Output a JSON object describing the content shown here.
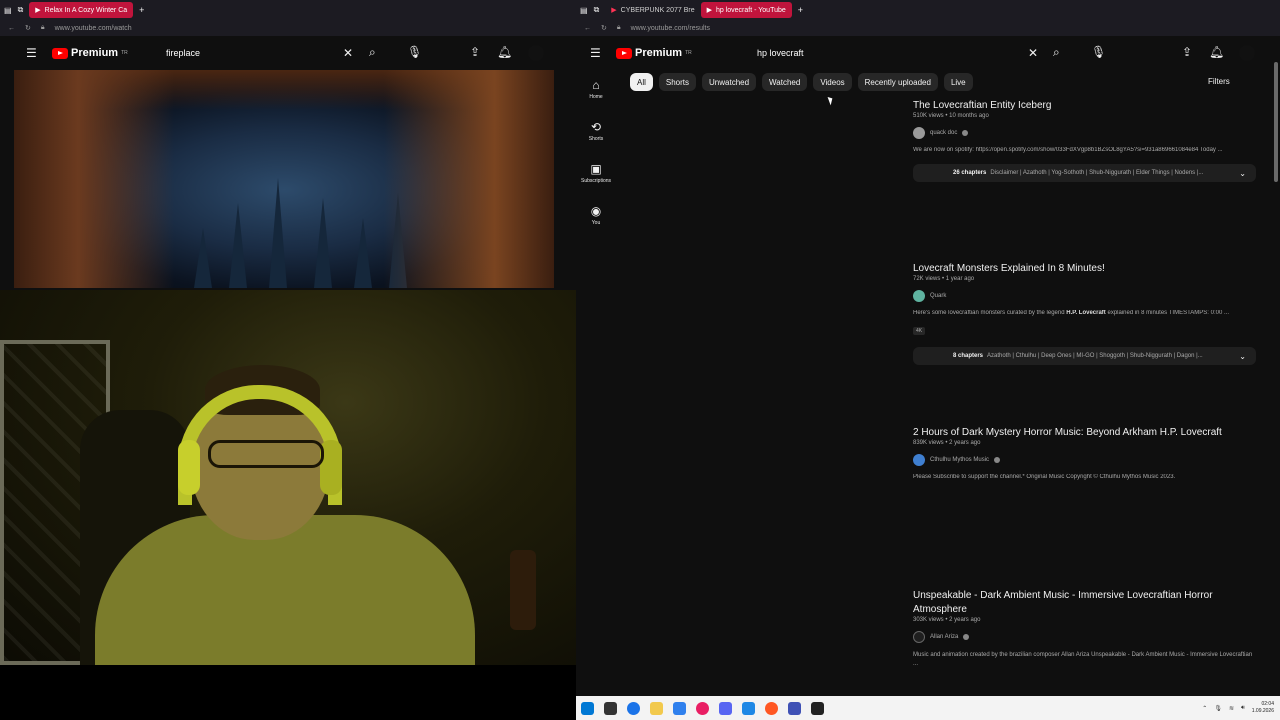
{
  "left_browser": {
    "tab_title": "Relax In A Cozy Winter Ca",
    "url": "www.youtube.com/watch",
    "logo_text": "Premium",
    "logo_region": "TR",
    "search_value": "fireplace"
  },
  "right_browser": {
    "tabs": [
      {
        "label": "CYBERPUNK 2077 Bre"
      },
      {
        "label": "hp lovecraft - YouTube"
      }
    ],
    "url": "www.youtube.com/results",
    "logo_text": "Premium",
    "logo_region": "TR",
    "search_value": "hp lovecraft",
    "sidebar": [
      {
        "label": "Home",
        "icon": "home-icon"
      },
      {
        "label": "Shorts",
        "icon": "shorts-icon"
      },
      {
        "label": "Subscriptions",
        "icon": "subscriptions-icon"
      },
      {
        "label": "You",
        "icon": "you-icon"
      }
    ],
    "chips": [
      "All",
      "Shorts",
      "Unwatched",
      "Watched",
      "Videos",
      "Recently uploaded",
      "Live"
    ],
    "filters_label": "Filters",
    "results": [
      {
        "title": "The Lovecraftian Entity Iceberg",
        "meta": "510K views • 10 months ago",
        "channel": "quack doc",
        "description": "We are now on spotify: https://open.spotify.com/show/033FdXVgp8b1BZsOL8gYA5?si=931a869661084e84 Today ...",
        "chapters_count": "26 chapters",
        "chapters_list": "Disclaimer | Azathoth | Yog-Sothoth | Shub-Niggurath | Elder Things | Nodens |..."
      },
      {
        "title": "Lovecraft Monsters Explained In 8 Minutes!",
        "meta": "72K views • 1 year ago",
        "channel": "Quark",
        "description_pre": "Here's some lovecraftian monsters curated by the legend ",
        "description_bold": "H.P. Lovecraft",
        "description_post": " explained in 8 minutes TIMESTAMPS: 0:00 ...",
        "badge": "4K",
        "chapters_count": "8 chapters",
        "chapters_list": "Azathoth | Cthulhu | Deep Ones | MI-GO | Shoggoth | Shub-Niggurath | Dagon |..."
      },
      {
        "title": "2 Hours of Dark Mystery Horror Music: Beyond Arkham H.P. Lovecraft",
        "meta": "839K views • 2 years ago",
        "channel": "Cthulhu Mythos Music",
        "description": "Please Subscribe to support the channel.* Original Music Copyright © Cthulhu Mythos Music 2023."
      },
      {
        "title": "Unspeakable - Dark Ambient Music - Immersive Lovecraftian Horror Atmosphere",
        "meta": "303K views • 2 years ago",
        "channel": "Allan Ariza",
        "description": "Music and animation created by the brazilian composer Allan Ariza Unspeakable - Dark Ambient Music - Immersive Lovecraftian ..."
      }
    ]
  },
  "taskbar": {
    "time": "02:04",
    "date": "1.09.2026"
  },
  "colors": {
    "accent": "#c0143c",
    "youtube_red": "#ff0000",
    "background": "#0f0f0f"
  }
}
